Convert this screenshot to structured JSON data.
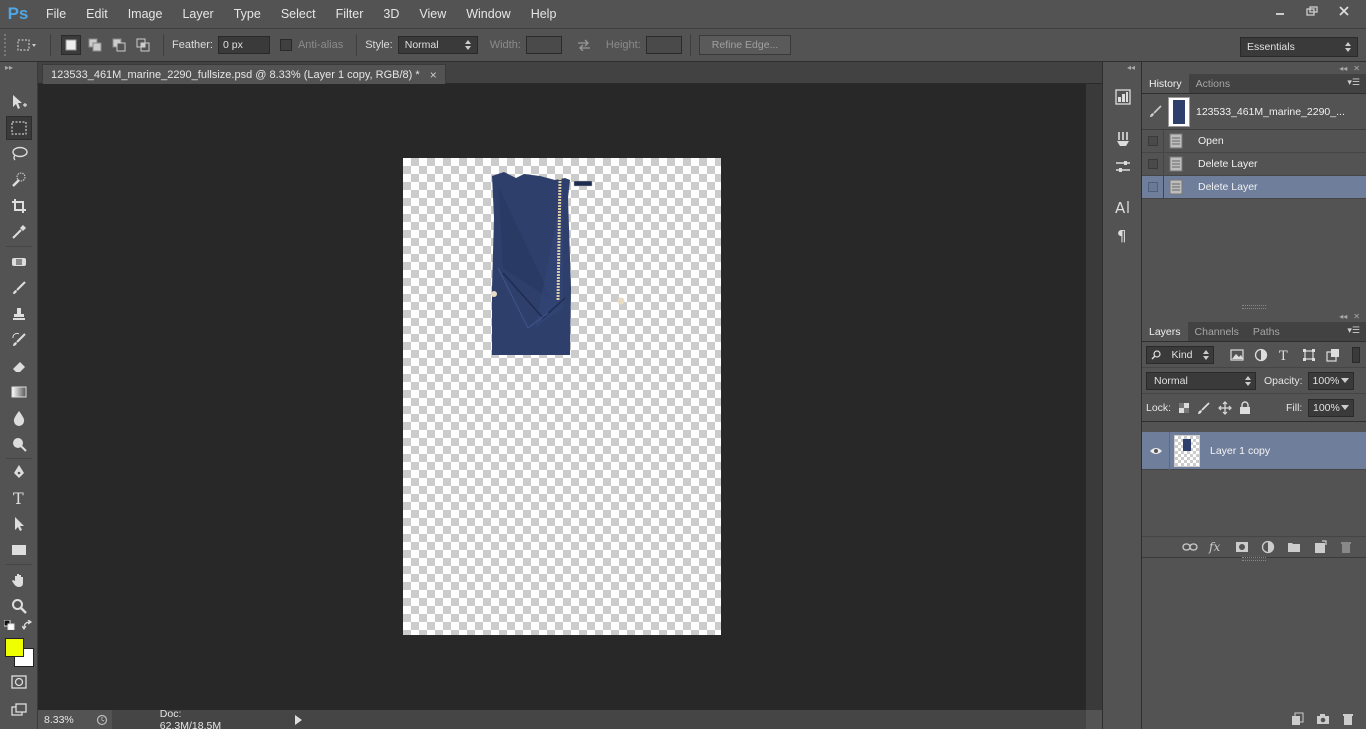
{
  "app": {
    "logo": "Ps",
    "menus": [
      "File",
      "Edit",
      "Image",
      "Layer",
      "Type",
      "Select",
      "Filter",
      "3D",
      "View",
      "Window",
      "Help"
    ],
    "window_controls": [
      "minimize",
      "restore",
      "close"
    ]
  },
  "options": {
    "feather_label": "Feather:",
    "feather_value": "0 px",
    "antialias_label": "Anti-alias",
    "style_label": "Style:",
    "style_value": "Normal",
    "width_label": "Width:",
    "height_label": "Height:",
    "refine_edge_label": "Refine Edge...",
    "workspace": "Essentials"
  },
  "document": {
    "tab_title": "123533_461M_marine_2290_fullsize.psd @ 8.33% (Layer 1 copy, RGB/8) *",
    "close_glyph": "×"
  },
  "status": {
    "zoom": "8.33%",
    "doc_info": "Doc: 62.3M/18.5M"
  },
  "colors": {
    "foreground": "#f0ff00",
    "background": "#ffffff",
    "selected_row": "#6f7f9b",
    "garment": "#2d3f6a"
  },
  "history": {
    "tabs": [
      "History",
      "Actions"
    ],
    "snapshot_label": "123533_461M_marine_2290_...",
    "items": [
      {
        "label": "Open",
        "selected": false
      },
      {
        "label": "Delete Layer",
        "selected": false
      },
      {
        "label": "Delete Layer",
        "selected": true
      }
    ]
  },
  "layers": {
    "tabs": [
      "Layers",
      "Channels",
      "Paths"
    ],
    "filter_kind": "Kind",
    "blend_mode": "Normal",
    "opacity_label": "Opacity:",
    "opacity_value": "100%",
    "lock_label": "Lock:",
    "fill_label": "Fill:",
    "fill_value": "100%",
    "items": [
      {
        "name": "Layer 1 copy",
        "visible": true,
        "selected": true
      }
    ]
  },
  "dock_icons": [
    "histogram-icon",
    "brush-presets-icon",
    "adjustments-icon",
    "character-icon",
    "paragraph-icon"
  ]
}
